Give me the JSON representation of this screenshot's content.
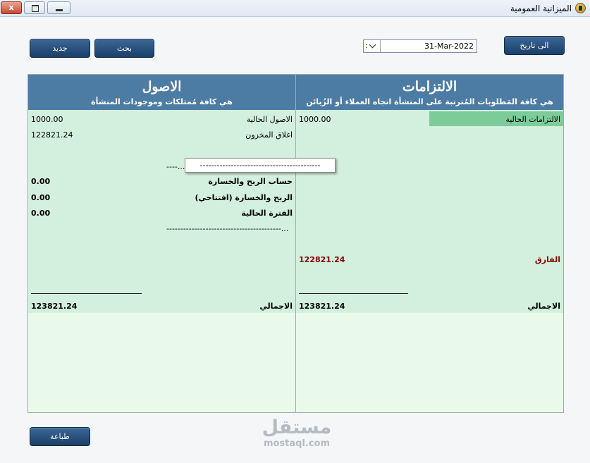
{
  "window": {
    "title": "الميزانية العمومية",
    "close_label": "x"
  },
  "toolbar": {
    "new_label": "جديد",
    "search_label": "بحث",
    "to_date_label": "الى تاريخ",
    "date_value": "31-Mar-2022",
    "date_spin_label": ":",
    "print_label": "طباعة"
  },
  "assets": {
    "title": "الاصول",
    "subtitle": "هي كافة مُمتلكات وموجودات المنشأة",
    "rows": [
      {
        "label": "الاصول الحالية",
        "value": "1000.00"
      },
      {
        "label": "اغلاق المخزون",
        "value": "122821.24"
      }
    ],
    "separator_text": "----...",
    "profit_rows": [
      {
        "label": "حساب الربح والخسارة",
        "value": "0.00"
      },
      {
        "label": "الربح والخسارة (افتتاحي)",
        "value": "0.00"
      },
      {
        "label": "الفترة الحالية",
        "value": "0.00"
      }
    ],
    "separator2_text": "-----------------------------------------...",
    "total_label": "الاجمالي",
    "total_value": "123821.24"
  },
  "liabilities": {
    "title": "الالتزامات",
    "subtitle": "هي كافة المَطلوبات المُترتبة على المنشأة اتجاه العملاء أو الزُبائن",
    "rows": [
      {
        "label": "الالتزامات الحالية",
        "value": "1000.00"
      }
    ],
    "difference_label": "الفارق",
    "difference_value": "122821.24",
    "total_label": "الاجمالي",
    "total_value": "123821.24"
  },
  "popup": {
    "text": "-------------------------------------------"
  },
  "watermark": {
    "arabic": "مستقل",
    "latin": "mostaql.com"
  }
}
